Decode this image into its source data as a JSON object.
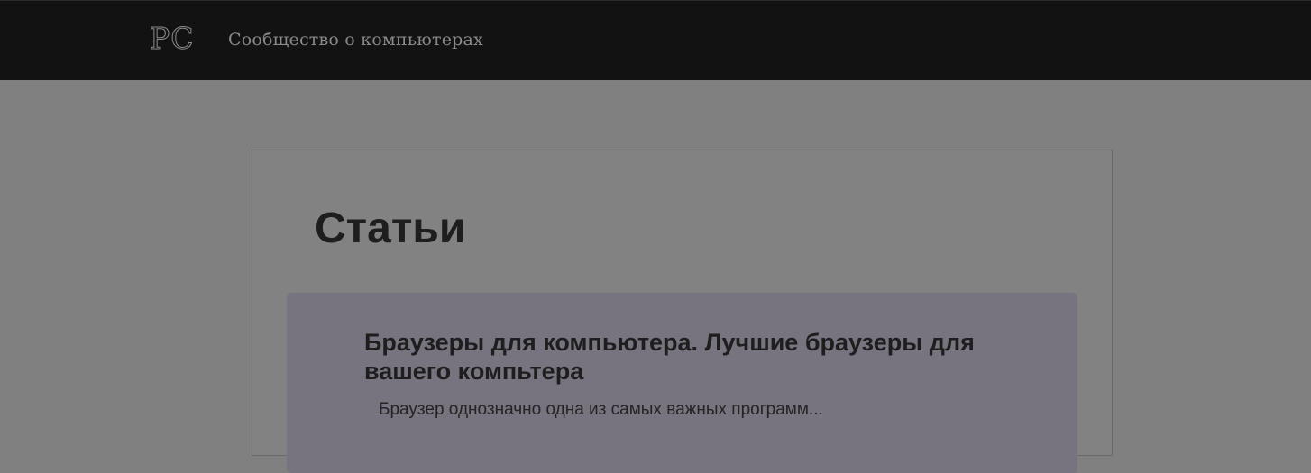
{
  "header": {
    "logo_text": "PC",
    "site_title": "Сообщество о компьютерах"
  },
  "main": {
    "heading": "Статьи",
    "articles": [
      {
        "title": "Браузеры для компьютера. Лучшие браузеры для вашего компьтера",
        "excerpt": "Браузер однозначно одна из самых важных программ..."
      }
    ]
  }
}
